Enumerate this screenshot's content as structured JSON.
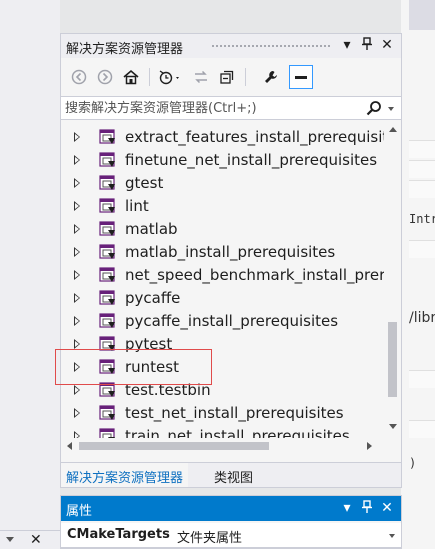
{
  "solution_explorer": {
    "title": "解决方案资源管理器",
    "buttons": {
      "dropdown_icon": "▾",
      "pin_icon": "⊣",
      "close_icon": "✕"
    },
    "toolbar": [
      "back-icon",
      "forward-icon",
      "home-icon",
      "history-icon",
      "sync-icon",
      "collapse-icon",
      "properties-wrench-icon",
      "show-all-files-icon"
    ],
    "search": {
      "placeholder": "搜索解决方案资源管理器(Ctrl+;)"
    },
    "tree_items": [
      {
        "label": "extract_features_install_prerequisites"
      },
      {
        "label": "finetune_net_install_prerequisites"
      },
      {
        "label": "gtest"
      },
      {
        "label": "lint"
      },
      {
        "label": "matlab"
      },
      {
        "label": "matlab_install_prerequisites"
      },
      {
        "label": "net_speed_benchmark_install_prerequisites"
      },
      {
        "label": "pycaffe"
      },
      {
        "label": "pycaffe_install_prerequisites"
      },
      {
        "label": "pytest"
      },
      {
        "label": "runtest"
      },
      {
        "label": "test.testbin"
      },
      {
        "label": "test_net_install_prerequisites"
      },
      {
        "label": "train_net_install_prerequisites"
      }
    ],
    "highlighted_item": "runtest",
    "tabs": [
      {
        "label": "解决方案资源管理器",
        "active": true
      },
      {
        "label": "类视图",
        "active": false
      }
    ]
  },
  "properties": {
    "title": "属性",
    "object_name": "CMakeTargets",
    "object_type": "文件夹属性"
  },
  "background": {
    "right_text_1": "Intr",
    "right_text_2": "/libr",
    "right_text_3": ")"
  },
  "colors": {
    "accent": "#007acc",
    "highlight_border": "#e04b4b",
    "tab_active_text": "#0e70c0"
  }
}
